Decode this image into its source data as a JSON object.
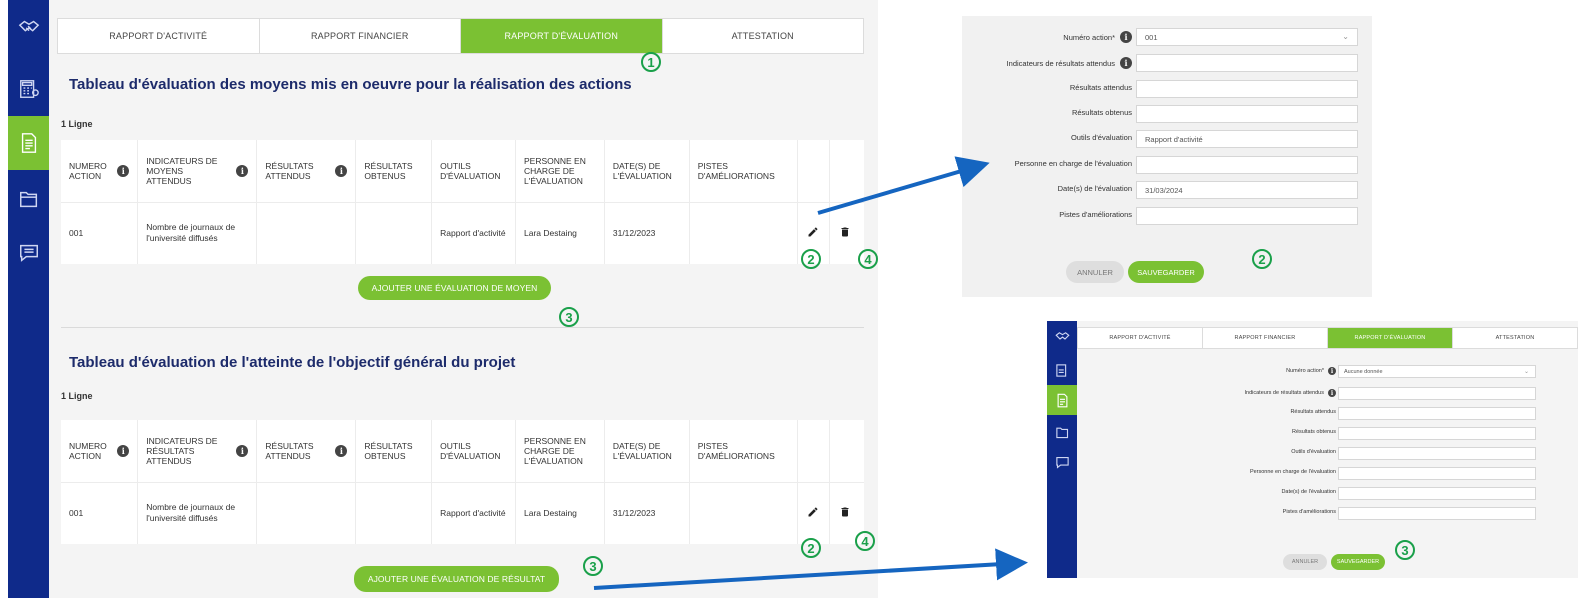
{
  "colors": {
    "navy": "#0f2a8a",
    "green": "#7bc133",
    "marker": "#1aa04a",
    "arrow": "#1565c0",
    "title": "#1d2b6b"
  },
  "sidebar": {
    "items": [
      {
        "icon": "handshake-icon"
      },
      {
        "icon": "calculator-icon"
      },
      {
        "icon": "document-icon",
        "active": true
      },
      {
        "icon": "folder-icon"
      },
      {
        "icon": "chat-icon"
      }
    ]
  },
  "tabs": [
    "RAPPORT D'ACTIVITÉ",
    "RAPPORT FINANCIER",
    "RAPPORT D'ÉVALUATION",
    "ATTESTATION"
  ],
  "section1": {
    "title": "Tableau d'évaluation des moyens mis en oeuvre pour la réalisation des actions",
    "count": "1 Ligne",
    "headers": [
      "NUMERO ACTION",
      "INDICATEURS DE MOYENS ATTENDUS",
      "RÉSULTATS ATTENDUS",
      "RÉSULTATS OBTENUS",
      "OUTILS D'ÉVALUATION",
      "PERSONNE EN CHARGE DE L'ÉVALUATION",
      "DATE(S) DE L'ÉVALUATION",
      "PISTES D'AMÉLIORATIONS"
    ],
    "row": [
      "001",
      "Nombre de journaux de l'université diffusés",
      "",
      "",
      "Rapport d'activité",
      "Lara Destaing",
      "31/12/2023",
      ""
    ],
    "button": "AJOUTER UNE ÉVALUATION DE MOYEN"
  },
  "section2": {
    "title": "Tableau d'évaluation de l'atteinte de l'objectif général du projet",
    "count": "1 Ligne",
    "headers": [
      "NUMERO ACTION",
      "INDICATEURS DE RÉSULTATS ATTENDUS",
      "RÉSULTATS ATTENDUS",
      "RÉSULTATS OBTENUS",
      "OUTILS D'ÉVALUATION",
      "PERSONNE EN CHARGE DE L'ÉVALUATION",
      "DATE(S) DE L'ÉVALUATION",
      "PISTES D'AMÉLIORATIONS"
    ],
    "row": [
      "001",
      "Nombre de journaux de l'université diffusés",
      "",
      "",
      "Rapport d'activité",
      "Lara Destaing",
      "31/12/2023",
      ""
    ],
    "button": "AJOUTER UNE ÉVALUATION DE RÉSULTAT"
  },
  "markers": {
    "m1": "1",
    "m2": "2",
    "m3": "3",
    "m4": "4"
  },
  "edit_form": {
    "fields": [
      {
        "label": "Numéro action*",
        "value": "001",
        "info": true,
        "select": true
      },
      {
        "label": "Indicateurs de résultats attendus",
        "value": "",
        "info": true
      },
      {
        "label": "Résultats attendus",
        "value": ""
      },
      {
        "label": "Résultats obtenus",
        "value": ""
      },
      {
        "label": "Outils d'évaluation",
        "value": "Rapport d'activité"
      },
      {
        "label": "Personne en charge de l'évaluation",
        "value": ""
      },
      {
        "label": "Date(s) de l'évaluation",
        "value": "31/03/2024"
      },
      {
        "label": "Pistes d'améliorations",
        "value": ""
      }
    ],
    "cancel": "ANNULER",
    "save": "SAUVEGARDER"
  },
  "add_form": {
    "tabs": [
      "RAPPORT D'ACTIVITÉ",
      "RAPPORT FINANCIER",
      "RAPPORT D'ÉVALUATION",
      "ATTESTATION"
    ],
    "fields": [
      {
        "label": "Numéro action*",
        "value": "Aucune donnée",
        "info": true,
        "select": true
      },
      {
        "label": "Indicateurs de résultats attendus",
        "value": "",
        "info": true
      },
      {
        "label": "Résultats attendus",
        "value": ""
      },
      {
        "label": "Résultats obtenus",
        "value": ""
      },
      {
        "label": "Outils d'évaluation",
        "value": ""
      },
      {
        "label": "Personne en charge de l'évaluation",
        "value": ""
      },
      {
        "label": "Date(s) de l'évaluation",
        "value": ""
      },
      {
        "label": "Pistes d'améliorations",
        "value": ""
      }
    ],
    "cancel": "ANNULER",
    "save": "SAUVEGARDER"
  }
}
